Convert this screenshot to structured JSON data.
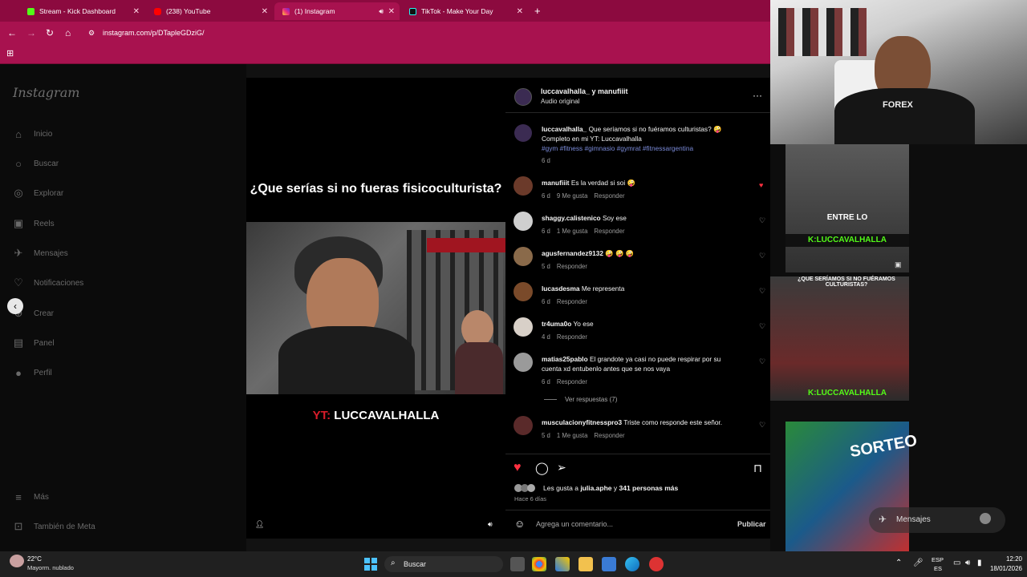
{
  "tabs": [
    {
      "title": "Stream - Kick Dashboard",
      "favicon_color": "#53fc18"
    },
    {
      "title": "(238) YouTube",
      "favicon_color": "#ff0000"
    },
    {
      "title": "(1) Instagram",
      "favicon_color": "#e1306c"
    },
    {
      "title": "TikTok - Make Your Day",
      "favicon_color": "#111111"
    }
  ],
  "url": "instagram.com/p/DTapleGDziG/",
  "instagram": {
    "logo": "Instagram",
    "nav": [
      {
        "label": "Inicio",
        "icon": "home-icon"
      },
      {
        "label": "Buscar",
        "icon": "search-icon"
      },
      {
        "label": "Explorar",
        "icon": "compass-icon"
      },
      {
        "label": "Reels",
        "icon": "reels-icon"
      },
      {
        "label": "Mensajes",
        "icon": "messenger-icon"
      },
      {
        "label": "Notificaciones",
        "icon": "heart-icon"
      },
      {
        "label": "Crear",
        "icon": "plus-icon"
      },
      {
        "label": "Panel",
        "icon": "chart-icon"
      },
      {
        "label": "Perfil",
        "icon": "avatar-icon"
      }
    ],
    "more": "Más",
    "meta": "También de Meta"
  },
  "video": {
    "title": "¿Que serías si no fueras fisicoculturista?",
    "caption_prefix": "YT: ",
    "caption_name": "LUCCAVALHALLA"
  },
  "post": {
    "author_line": "luccavalhalla_ y manufiiit",
    "audio": "Audio original",
    "caption_user": "luccavalhalla_",
    "caption_text": "Que seríamos si no fuéramos culturistas? 🤪 Completo en mi YT: Luccavalhalla",
    "hashtags": "#gym #fitness #gimnasio #gymrat #fitnessargentina",
    "caption_time": "6 d",
    "comments": [
      {
        "user": "manufiiit",
        "text": "Es la verdad si soi 🤪",
        "time": "6 d",
        "likes": "9 Me gusta",
        "reply": "Responder",
        "liked": true
      },
      {
        "user": "shaggy.calistenico",
        "text": "Soy ese",
        "time": "6 d",
        "likes": "1 Me gusta",
        "reply": "Responder",
        "liked": false
      },
      {
        "user": "agusfernandez9132",
        "text": "🤪 🤪 🤪",
        "time": "5 d",
        "likes": "",
        "reply": "Responder",
        "liked": false
      },
      {
        "user": "lucasdesma",
        "text": "Me representa",
        "time": "6 d",
        "likes": "",
        "reply": "Responder",
        "liked": false
      },
      {
        "user": "tr4uma0o",
        "text": "Yo ese",
        "time": "4 d",
        "likes": "",
        "reply": "Responder",
        "liked": false
      },
      {
        "user": "matias25pablo",
        "text": "El grandote ya casi no puede respirar por su cuenta xd entubenlo antes que se nos vaya",
        "time": "6 d",
        "likes": "",
        "reply": "Responder",
        "liked": false
      },
      {
        "user": "musculacionyfitnesspro3",
        "text": "Triste como responde este señor.",
        "time": "5 d",
        "likes": "1 Me gusta",
        "reply": "Responder",
        "liked": false
      }
    ],
    "view_replies": "Ver respuestas (7)",
    "likes_prefix": "Les gusta a ",
    "likes_user": "julia.aphe",
    "likes_mid": " y ",
    "likes_count": "341 personas más",
    "posted": "Hace 6 días",
    "comment_placeholder": "Agrega un comentario...",
    "publish": "Publicar"
  },
  "right": {
    "thumb1_top": "ENTRE LO",
    "thumb1_brand": "K:LUCCAVALHALLA",
    "thumb2_top": "¿QUE SERÍAMOS SI NO FUÉRAMOS CULTURISTAS?",
    "thumb2_brand": "K:LUCCAVALHALLA",
    "thumb3_text": "SORTEO",
    "messages": "Mensajes"
  },
  "taskbar": {
    "weather_temp": "22°C",
    "weather_desc": "Mayorm. nublado",
    "search": "Buscar",
    "lang1": "ESP",
    "lang2": "ES",
    "time": "12:20",
    "date": "18/01/2026"
  }
}
